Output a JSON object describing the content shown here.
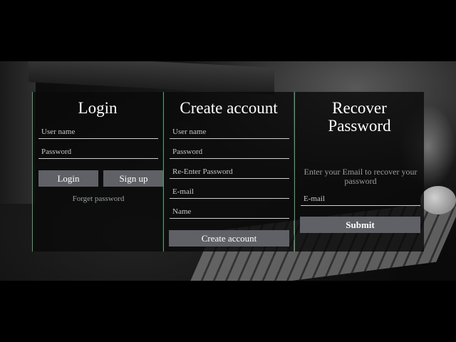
{
  "login": {
    "title": "Login",
    "username_placeholder": "User name",
    "password_placeholder": "Password",
    "login_button": "Login",
    "signup_button": "Sign up",
    "forget_link": "Forget password"
  },
  "create": {
    "title": "Create account",
    "username_placeholder": "User name",
    "password_placeholder": "Password",
    "reenter_placeholder": "Re-Enter Password",
    "email_placeholder": "E-mail",
    "name_placeholder": "Name",
    "create_button": "Create account"
  },
  "recover": {
    "title_line1": "Recover",
    "title_line2": "Password",
    "info": "Enter your Email to recover your password",
    "email_placeholder": "E-mail",
    "submit_button": "Submit"
  },
  "colors": {
    "accent_border": "#4fa36a",
    "button_bg": "#5f6166",
    "panel_bg": "#0a0a0a"
  }
}
